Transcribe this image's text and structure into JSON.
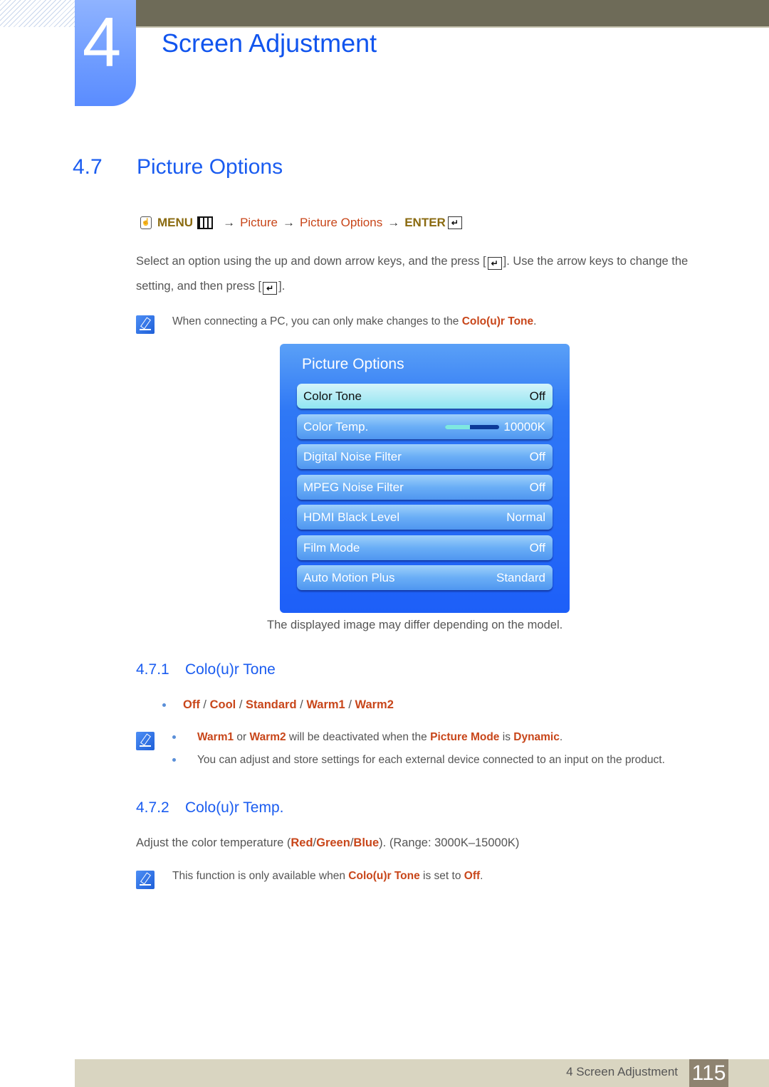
{
  "header": {
    "chapter_number": "4",
    "chapter_title": "Screen Adjustment"
  },
  "section": {
    "number": "4.7",
    "title": "Picture Options"
  },
  "menu_path": {
    "menu": "MENU",
    "arrow": "→",
    "step1": "Picture",
    "step2": "Picture Options",
    "enter": "ENTER"
  },
  "intro": {
    "part1": "Select an option using the up and down arrow keys, and the press [",
    "part2": "]. Use the arrow keys to change the setting, and then press [",
    "part3": "]."
  },
  "note1": {
    "text": "When connecting a PC, you can only make changes to the ",
    "highlight": "Colo(u)r Tone",
    "end": "."
  },
  "osd": {
    "title": "Picture Options",
    "rows": [
      {
        "label": "Color Tone",
        "value": "Off",
        "selected": true
      },
      {
        "label": "Color Temp.",
        "value": "10000K",
        "slider_fraction": 0.45
      },
      {
        "label": "Digital Noise Filter",
        "value": "Off"
      },
      {
        "label": "MPEG Noise Filter",
        "value": "Off"
      },
      {
        "label": "HDMI Black Level",
        "value": "Normal"
      },
      {
        "label": "Film Mode",
        "value": "Off"
      },
      {
        "label": "Auto Motion Plus",
        "value": "Standard"
      }
    ]
  },
  "caption": "The displayed image may differ depending on the model.",
  "sub1": {
    "number": "4.7.1",
    "title": "Colo(u)r Tone",
    "options": [
      "Off",
      "Cool",
      "Standard",
      "Warm1",
      "Warm2"
    ],
    "separator": " / ",
    "note_line1": {
      "a": "Warm1",
      "b": " or ",
      "c": "Warm2",
      "d": " will be deactivated when the ",
      "e": "Picture Mode",
      "f": " is ",
      "g": "Dynamic",
      "h": "."
    },
    "note_line2": "You can adjust and store settings for each external device connected to an input on the product."
  },
  "sub2": {
    "number": "4.7.2",
    "title": "Colo(u)r Temp.",
    "desc": {
      "a": "Adjust the color temperature (",
      "red": "Red",
      "s1": "/",
      "green": "Green",
      "s2": "/",
      "blue": "Blue",
      "b": "). (Range: 3000K–15000K)"
    },
    "note": {
      "a": "This function is only available when ",
      "b": "Colo(u)r Tone",
      "c": " is set to ",
      "d": "Off",
      "e": "."
    }
  },
  "footer": {
    "text": "4 Screen Adjustment",
    "page": "115"
  },
  "colors": {
    "heading_blue": "#1a5cf0",
    "highlight_red": "#c8461a",
    "menu_gold": "#8a6a10",
    "osd_blue": "#1d5ff8",
    "footer_bg": "#d9d5c1",
    "page_num_bg": "#8e8370"
  }
}
